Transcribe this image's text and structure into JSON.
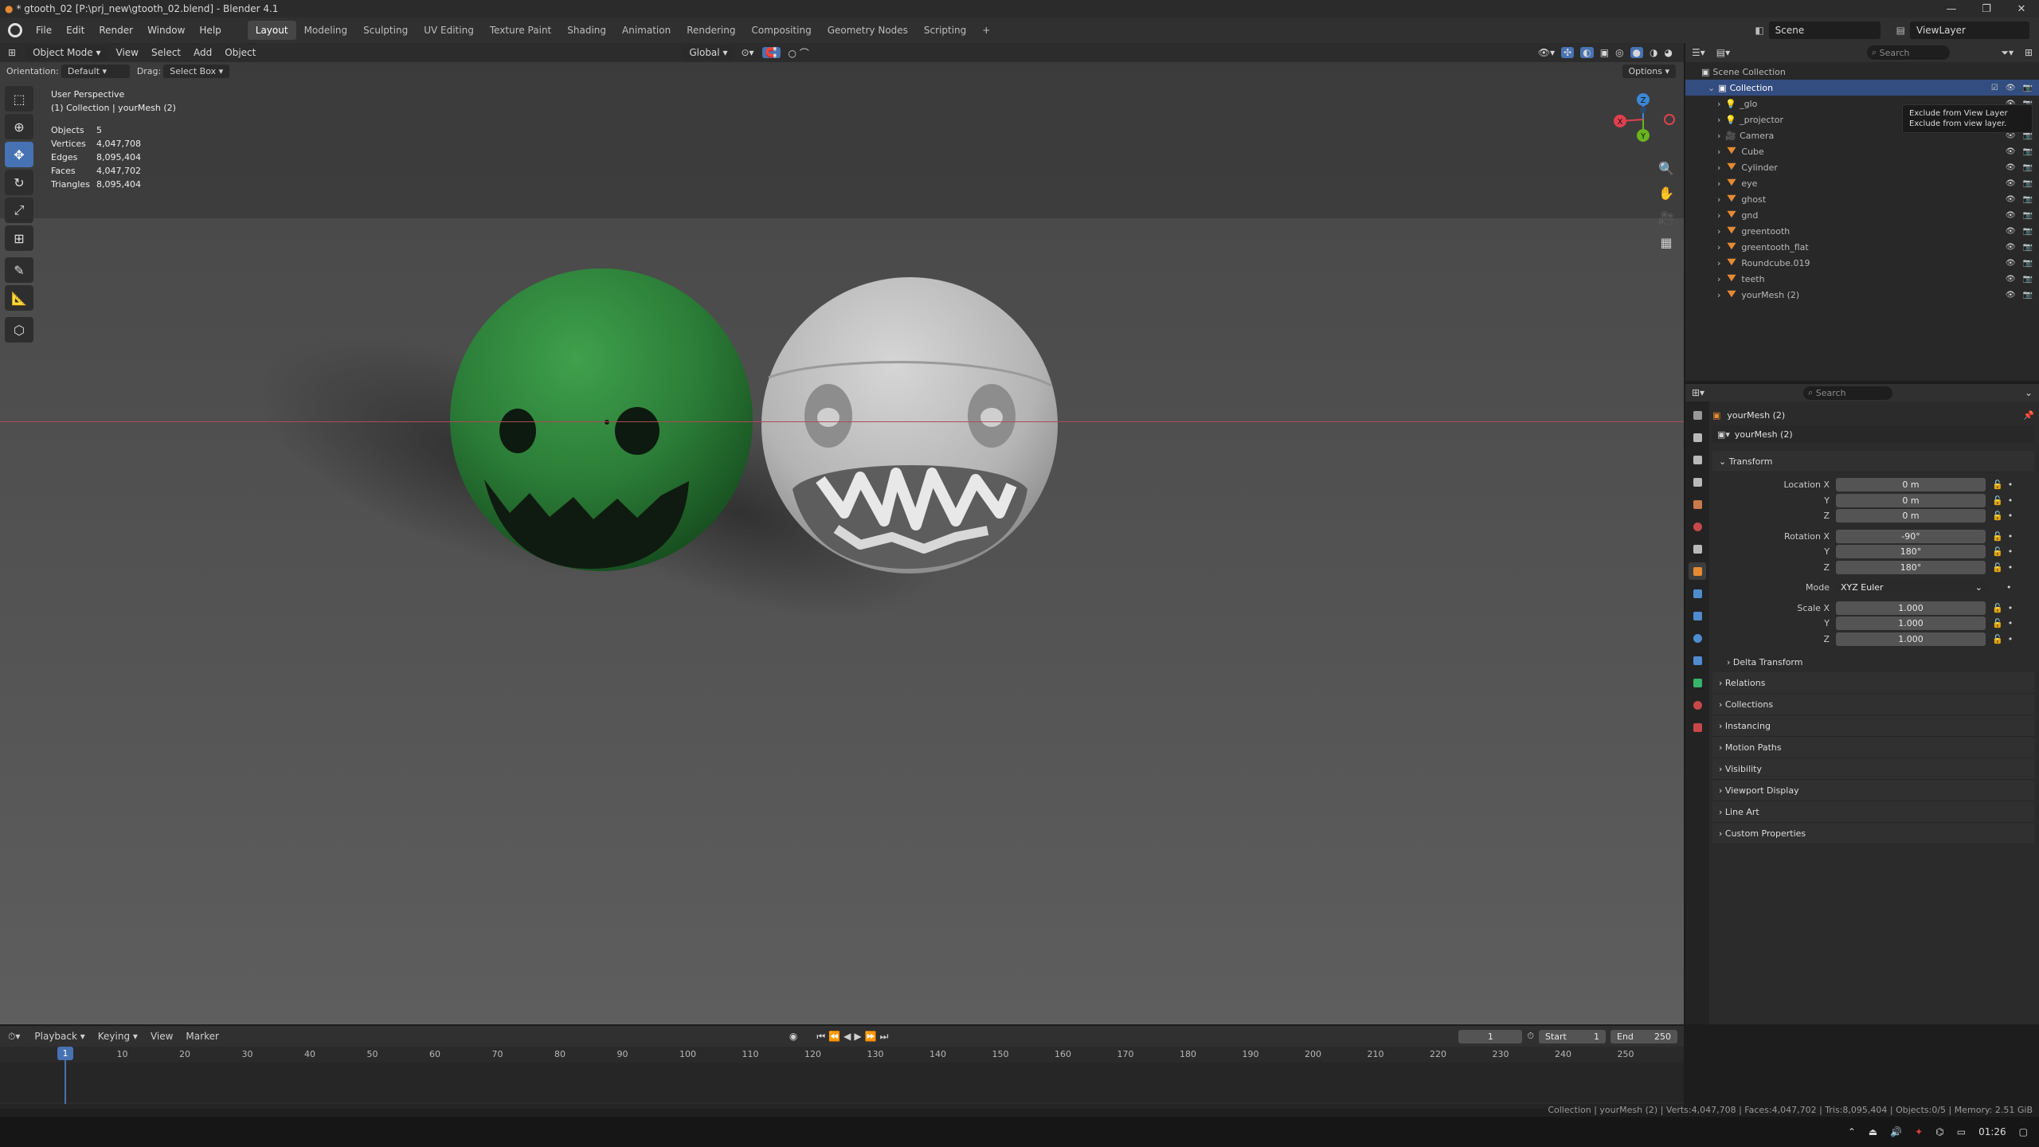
{
  "titlebar": {
    "title": "* gtooth_02 [P:\\prj_new\\gtooth_02.blend] - Blender 4.1"
  },
  "menubar": {
    "menus": [
      "File",
      "Edit",
      "Render",
      "Window",
      "Help"
    ],
    "workspaces": [
      "Layout",
      "Modeling",
      "Sculpting",
      "UV Editing",
      "Texture Paint",
      "Shading",
      "Animation",
      "Rendering",
      "Compositing",
      "Geometry Nodes",
      "Scripting"
    ],
    "active_workspace": "Layout",
    "scene": "Scene",
    "view_layer": "ViewLayer"
  },
  "viewport_header": {
    "mode": "Object Mode",
    "menus": [
      "View",
      "Select",
      "Add",
      "Object"
    ],
    "transform_orientation": "Global",
    "orientation_label": "Orientation:",
    "orientation_value": "Default",
    "drag_label": "Drag:",
    "drag_value": "Select Box",
    "options_label": "Options"
  },
  "viewport_overlay": {
    "view_name": "User Perspective",
    "context": "(1) Collection | yourMesh (2)",
    "stats": [
      {
        "label": "Objects",
        "value": "5"
      },
      {
        "label": "Vertices",
        "value": "4,047,708"
      },
      {
        "label": "Edges",
        "value": "8,095,404"
      },
      {
        "label": "Faces",
        "value": "4,047,702"
      },
      {
        "label": "Triangles",
        "value": "8,095,404"
      }
    ]
  },
  "gizmo": {
    "x": "X",
    "y": "Y",
    "z": "Z"
  },
  "outliner": {
    "search_placeholder": "Search",
    "root": "Scene Collection",
    "collection": "Collection",
    "items": [
      {
        "name": "_glo",
        "type": "light"
      },
      {
        "name": "_projector",
        "type": "light"
      },
      {
        "name": "Camera",
        "type": "camera"
      },
      {
        "name": "Cube",
        "type": "mesh"
      },
      {
        "name": "Cylinder",
        "type": "mesh"
      },
      {
        "name": "eye",
        "type": "mesh"
      },
      {
        "name": "ghost",
        "type": "mesh"
      },
      {
        "name": "gnd",
        "type": "mesh"
      },
      {
        "name": "greentooth",
        "type": "mesh"
      },
      {
        "name": "greentooth_flat",
        "type": "mesh"
      },
      {
        "name": "Roundcube.019",
        "type": "mesh"
      },
      {
        "name": "teeth",
        "type": "mesh"
      },
      {
        "name": "yourMesh (2)",
        "type": "mesh"
      }
    ],
    "tooltip_line1": "Exclude from View Layer",
    "tooltip_line2": "Exclude from view layer."
  },
  "properties": {
    "search_placeholder": "Search",
    "object_name": "yourMesh (2)",
    "data_name": "yourMesh (2)",
    "transform_title": "Transform",
    "location_label": "Location X",
    "location": [
      "0 m",
      "0 m",
      "0 m"
    ],
    "rotation_label": "Rotation X",
    "rotation": [
      "-90°",
      "180°",
      "180°"
    ],
    "mode_label": "Mode",
    "mode_value": "XYZ Euler",
    "scale_label": "Scale X",
    "scale": [
      "1.000",
      "1.000",
      "1.000"
    ],
    "axis_y": "Y",
    "axis_z": "Z",
    "delta_transform": "Delta Transform",
    "panels": [
      "Relations",
      "Collections",
      "Instancing",
      "Motion Paths",
      "Visibility",
      "Viewport Display",
      "Line Art",
      "Custom Properties"
    ]
  },
  "timeline": {
    "menus": [
      "Playback",
      "Keying",
      "View",
      "Marker"
    ],
    "current_frame": "1",
    "start_label": "Start",
    "start": "1",
    "end_label": "End",
    "end": "250",
    "ruler": [
      "10",
      "20",
      "30",
      "40",
      "50",
      "60",
      "70",
      "80",
      "90",
      "100",
      "110",
      "120",
      "130",
      "140",
      "150",
      "160",
      "170",
      "180",
      "190",
      "200",
      "210",
      "220",
      "230",
      "240",
      "250"
    ],
    "playhead_label": "1"
  },
  "statusbar": {
    "text": "Collection | yourMesh (2) | Verts:4,047,708 | Faces:4,047,702 | Tris:8,095,404 | Objects:0/5 | Memory: 2.51 GiB"
  },
  "taskbar": {
    "time": "01:26"
  },
  "colors": {
    "active_blue": "#4772b3",
    "green_head": "#2e8b3c",
    "axis_x": "#e0404e",
    "axis_y": "#6ab41f",
    "axis_z": "#3d87d6"
  }
}
